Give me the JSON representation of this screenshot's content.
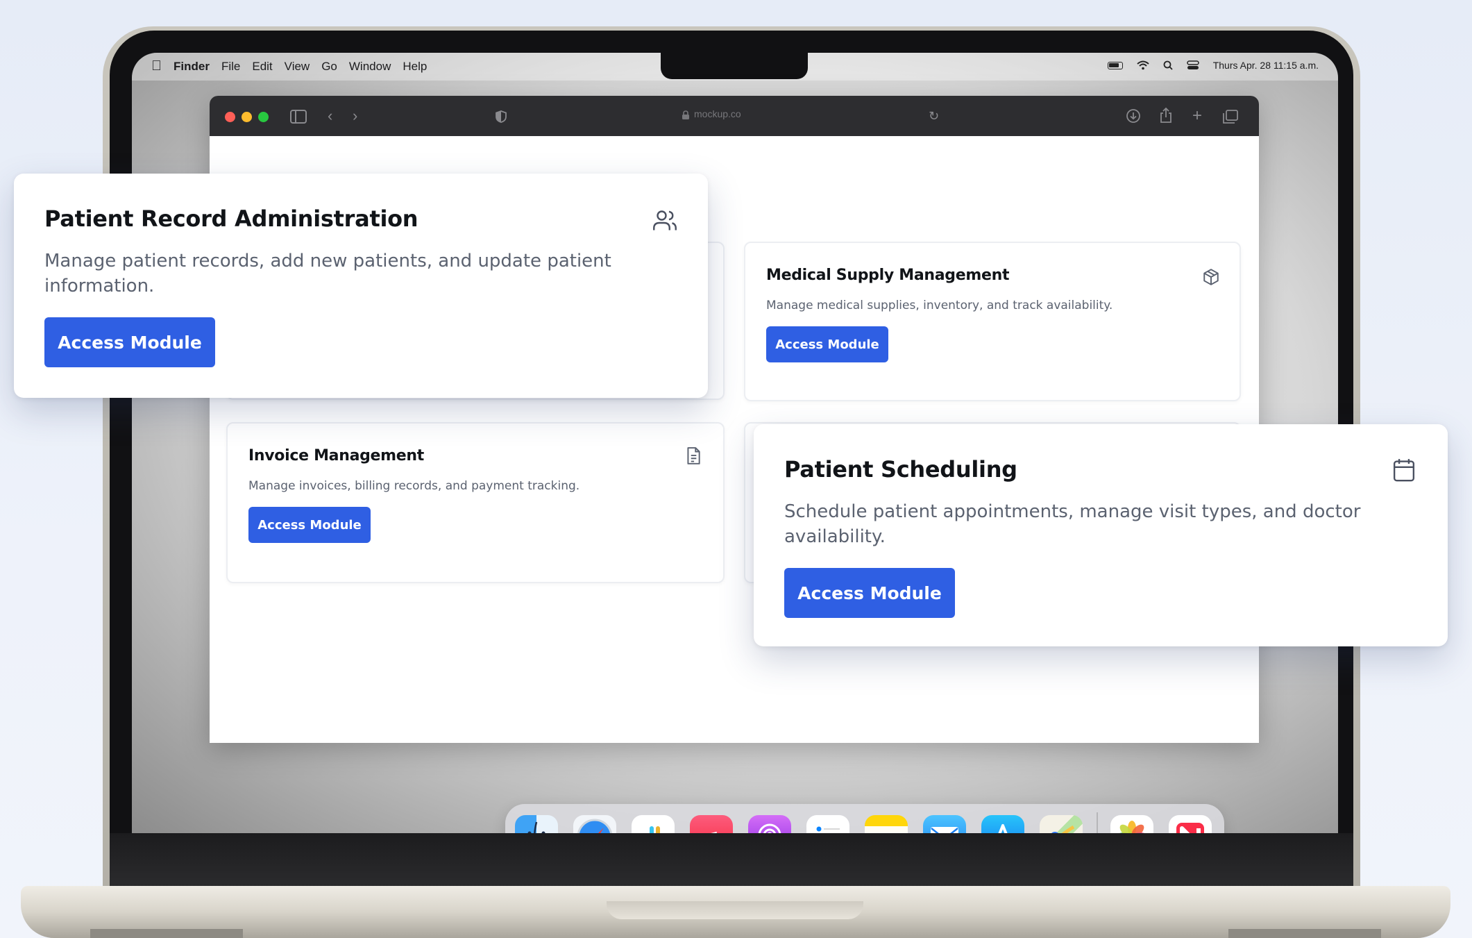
{
  "menubar": {
    "app_name": "Finder",
    "items": [
      "File",
      "Edit",
      "View",
      "Go",
      "Window",
      "Help"
    ],
    "datetime": "Thurs Apr. 28  11:15 a.m."
  },
  "browser": {
    "url": "mockup.co"
  },
  "modules": {
    "patient_records": {
      "title": "Patient Record Administration",
      "description": "Manage patient records, add new patients, and update patient information.",
      "button": "Access Module",
      "icon": "users-icon"
    },
    "medical_supply": {
      "title": "Medical Supply Management",
      "description": "Manage medical supplies, inventory, and track availability.",
      "button": "Access Module",
      "icon": "package-icon"
    },
    "invoice": {
      "title": "Invoice Management",
      "description": "Manage invoices, billing records, and payment tracking.",
      "button": "Access Module",
      "icon": "document-icon"
    },
    "scheduling": {
      "title": "Patient Scheduling",
      "description": "Schedule patient appointments, manage visit types, and doctor availability.",
      "button": "Access Module",
      "icon": "calendar-icon"
    }
  },
  "dock": {
    "apps": [
      "finder",
      "safari",
      "slack",
      "music",
      "podcasts",
      "reminders",
      "notes",
      "mail",
      "app-store",
      "maps",
      "photos",
      "news"
    ]
  },
  "colors": {
    "accent": "#2f5fe3",
    "title_text": "#111418",
    "body_text": "#5b6270"
  }
}
